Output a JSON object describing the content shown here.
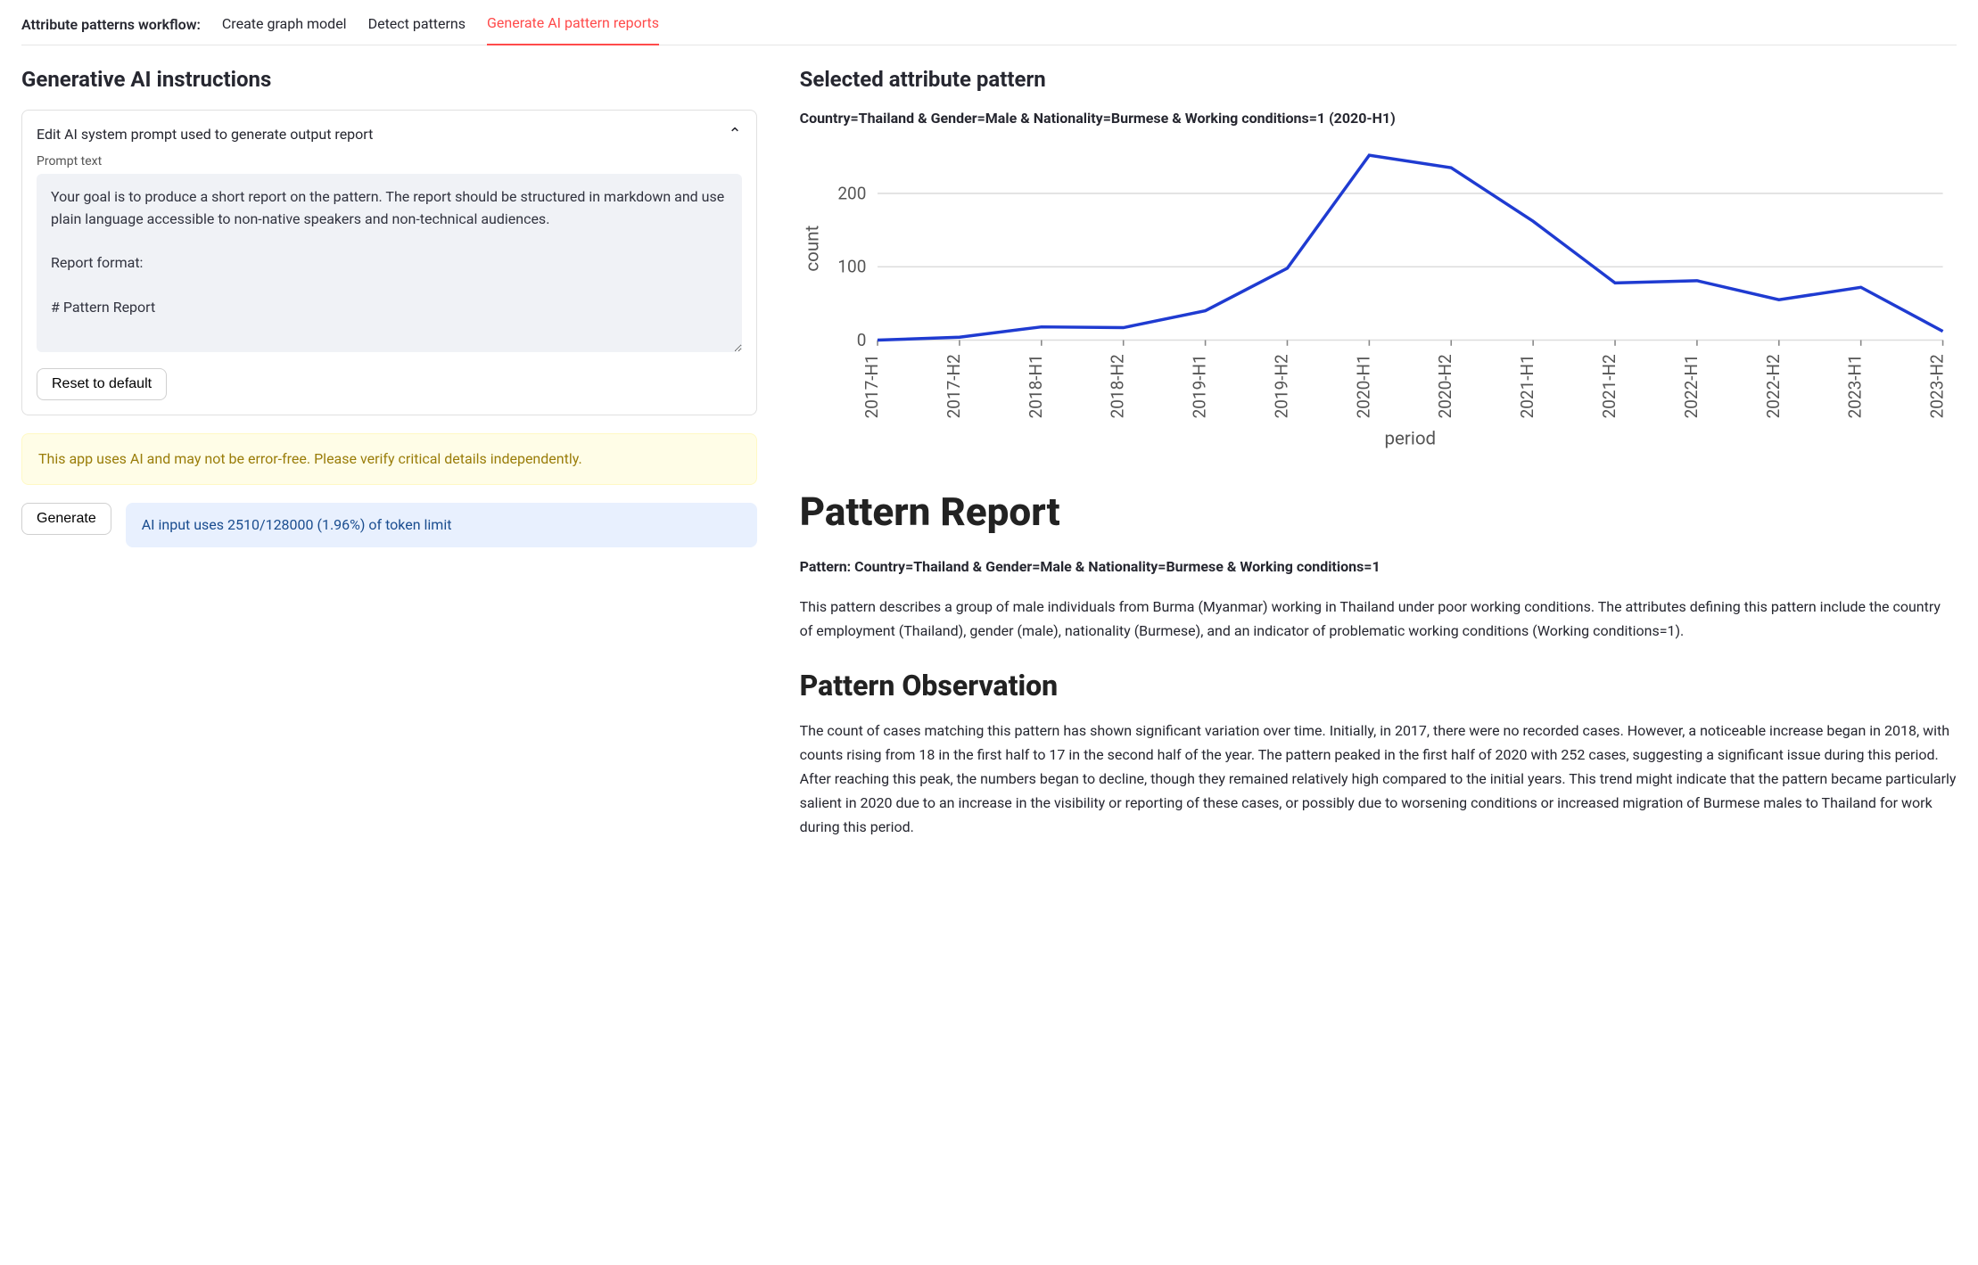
{
  "workflow": {
    "label": "Attribute patterns workflow:",
    "steps": [
      "Create graph model",
      "Detect patterns",
      "Generate AI pattern reports"
    ],
    "active_index": 2
  },
  "left": {
    "title": "Generative AI instructions",
    "expander_label": "Edit AI system prompt used to generate output report",
    "prompt_label": "Prompt text",
    "prompt_text": "Your goal is to produce a short report on the pattern. The report should be structured in markdown and use plain language accessible to non-native speakers and non-technical audiences.\n\nReport format:\n\n# Pattern Report",
    "reset_label": "Reset to default",
    "warning_text": "This app uses AI and may not be error-free. Please verify critical details independently.",
    "generate_label": "Generate",
    "token_info": "AI input uses 2510/128000 (1.96%) of token limit"
  },
  "right": {
    "title": "Selected attribute pattern",
    "pattern_label": "Country=Thailand & Gender=Male & Nationality=Burmese & Working conditions=1 (2020-H1)"
  },
  "chart_data": {
    "type": "line",
    "xlabel": "period",
    "ylabel": "count",
    "ylim": [
      0,
      250
    ],
    "yticks": [
      0,
      100,
      200
    ],
    "categories": [
      "2017-H1",
      "2017-H2",
      "2018-H1",
      "2018-H2",
      "2019-H1",
      "2019-H2",
      "2020-H1",
      "2020-H2",
      "2021-H1",
      "2021-H2",
      "2022-H1",
      "2022-H2",
      "2023-H1",
      "2023-H2"
    ],
    "values": [
      0,
      4,
      18,
      17,
      40,
      98,
      252,
      235,
      162,
      78,
      81,
      55,
      72,
      12
    ],
    "series_color": "#1f3bd1"
  },
  "report": {
    "h1": "Pattern Report",
    "pattern_line": "Pattern: Country=Thailand & Gender=Male & Nationality=Burmese & Working conditions=1",
    "p1": "This pattern describes a group of male individuals from Burma (Myanmar) working in Thailand under poor working conditions. The attributes defining this pattern include the country of employment (Thailand), gender (male), nationality (Burmese), and an indicator of problematic working conditions (Working conditions=1).",
    "h2": "Pattern Observation",
    "p2": "The count of cases matching this pattern has shown significant variation over time. Initially, in 2017, there were no recorded cases. However, a noticeable increase began in 2018, with counts rising from 18 in the first half to 17 in the second half of the year. The pattern peaked in the first half of 2020 with 252 cases, suggesting a significant issue during this period. After reaching this peak, the numbers began to decline, though they remained relatively high compared to the initial years. This trend might indicate that the pattern became particularly salient in 2020 due to an increase in the visibility or reporting of these cases, or possibly due to worsening conditions or increased migration of Burmese males to Thailand for work during this period."
  }
}
